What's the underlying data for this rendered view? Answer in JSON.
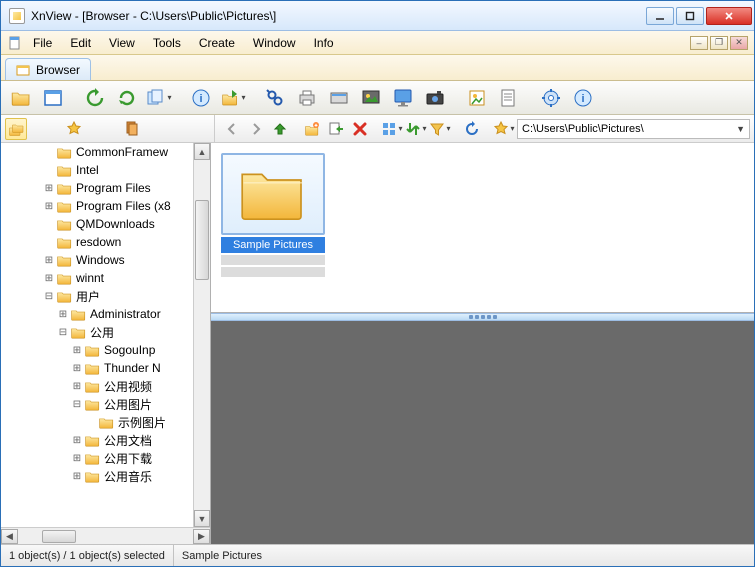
{
  "window": {
    "title": "XnView - [Browser - C:\\Users\\Public\\Pictures\\]"
  },
  "menu": {
    "file": "File",
    "edit": "Edit",
    "view": "View",
    "tools": "Tools",
    "create": "Create",
    "window": "Window",
    "info": "Info"
  },
  "tab": {
    "label": "Browser"
  },
  "path": {
    "value": "C:\\Users\\Public\\Pictures\\"
  },
  "tree": [
    {
      "indent": 3,
      "exp": "",
      "label": "CommonFramew"
    },
    {
      "indent": 3,
      "exp": "",
      "label": "Intel"
    },
    {
      "indent": 3,
      "exp": "+",
      "label": "Program Files"
    },
    {
      "indent": 3,
      "exp": "+",
      "label": "Program Files (x8"
    },
    {
      "indent": 3,
      "exp": "",
      "label": "QMDownloads"
    },
    {
      "indent": 3,
      "exp": "",
      "label": "resdown"
    },
    {
      "indent": 3,
      "exp": "+",
      "label": "Windows"
    },
    {
      "indent": 3,
      "exp": "+",
      "label": "winnt"
    },
    {
      "indent": 3,
      "exp": "-",
      "label": "用户"
    },
    {
      "indent": 4,
      "exp": "+",
      "label": "Administrator"
    },
    {
      "indent": 4,
      "exp": "-",
      "label": "公用"
    },
    {
      "indent": 5,
      "exp": "+",
      "label": "SogouInp"
    },
    {
      "indent": 5,
      "exp": "+",
      "label": "Thunder N"
    },
    {
      "indent": 5,
      "exp": "+",
      "label": "公用视频"
    },
    {
      "indent": 5,
      "exp": "-",
      "label": "公用图片"
    },
    {
      "indent": 6,
      "exp": "",
      "label": "示例图片"
    },
    {
      "indent": 5,
      "exp": "+",
      "label": "公用文档"
    },
    {
      "indent": 5,
      "exp": "+",
      "label": "公用下载"
    },
    {
      "indent": 5,
      "exp": "+",
      "label": "公用音乐"
    }
  ],
  "selected_thumb": {
    "label": "Sample Pictures"
  },
  "status": {
    "left": "1 object(s) / 1 object(s) selected",
    "mid": "Sample Pictures"
  }
}
